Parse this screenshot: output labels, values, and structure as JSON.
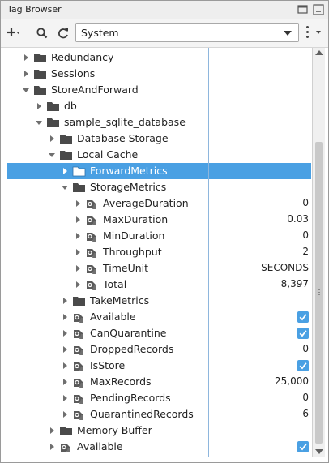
{
  "window": {
    "title": "Tag Browser"
  },
  "toolbar": {
    "provider": "System"
  },
  "tree": {
    "rows": [
      {
        "label": "Redundancy",
        "icon": "folder-icon",
        "expanded": false,
        "value": "",
        "checked": false
      },
      {
        "label": "Sessions",
        "icon": "folder-icon",
        "expanded": false,
        "value": "",
        "checked": false
      },
      {
        "label": "StoreAndForward",
        "icon": "folder-icon",
        "expanded": true,
        "value": "",
        "checked": false
      },
      {
        "label": "db",
        "icon": "folder-icon",
        "expanded": false,
        "value": "",
        "checked": false
      },
      {
        "label": "sample_sqlite_database",
        "icon": "folder-icon",
        "expanded": true,
        "value": "",
        "checked": false
      },
      {
        "label": "Database Storage",
        "icon": "folder-icon",
        "expanded": false,
        "value": "",
        "checked": false
      },
      {
        "label": "Local Cache",
        "icon": "folder-icon",
        "expanded": true,
        "value": "",
        "checked": false
      },
      {
        "label": "ForwardMetrics",
        "icon": "folder-icon",
        "expanded": false,
        "value": "",
        "checked": false,
        "selected": true
      },
      {
        "label": "StorageMetrics",
        "icon": "folder-icon",
        "expanded": true,
        "value": "",
        "checked": false
      },
      {
        "label": "AverageDuration",
        "icon": "tag-icon",
        "expanded": false,
        "value": "0",
        "checked": false
      },
      {
        "label": "MaxDuration",
        "icon": "tag-icon",
        "expanded": false,
        "value": "0.03",
        "checked": false
      },
      {
        "label": "MinDuration",
        "icon": "tag-icon",
        "expanded": false,
        "value": "0",
        "checked": false
      },
      {
        "label": "Throughput",
        "icon": "tag-icon",
        "expanded": false,
        "value": "2",
        "checked": false
      },
      {
        "label": "TimeUnit",
        "icon": "tag-icon",
        "expanded": false,
        "value": "SECONDS",
        "checked": false
      },
      {
        "label": "Total",
        "icon": "tag-icon",
        "expanded": false,
        "value": "8,397",
        "checked": false
      },
      {
        "label": "TakeMetrics",
        "icon": "folder-icon",
        "expanded": false,
        "value": "",
        "checked": false
      },
      {
        "label": "Available",
        "icon": "tag-icon",
        "expanded": false,
        "value": "",
        "checked": true
      },
      {
        "label": "CanQuarantine",
        "icon": "tag-icon",
        "expanded": false,
        "value": "",
        "checked": true
      },
      {
        "label": "DroppedRecords",
        "icon": "tag-icon",
        "expanded": false,
        "value": "0",
        "checked": false
      },
      {
        "label": "IsStore",
        "icon": "tag-icon",
        "expanded": false,
        "value": "",
        "checked": true
      },
      {
        "label": "MaxRecords",
        "icon": "tag-icon",
        "expanded": false,
        "value": "25,000",
        "checked": false
      },
      {
        "label": "PendingRecords",
        "icon": "tag-icon",
        "expanded": false,
        "value": "0",
        "checked": false
      },
      {
        "label": "QuarantinedRecords",
        "icon": "tag-icon",
        "expanded": false,
        "value": "6",
        "checked": false
      },
      {
        "label": "Memory Buffer",
        "icon": "folder-icon",
        "expanded": false,
        "value": "",
        "checked": false
      },
      {
        "label": "Available",
        "icon": "tag-icon",
        "expanded": false,
        "value": "",
        "checked": true
      }
    ]
  },
  "colors": {
    "selection": "#4aa0e3",
    "accent": "#4aa0e3",
    "folder": "#4a4a4a"
  }
}
